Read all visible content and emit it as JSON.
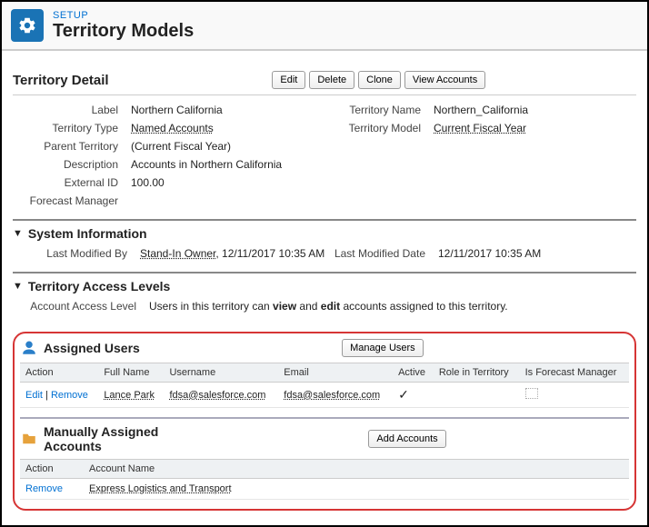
{
  "header": {
    "breadcrumb": "SETUP",
    "title": "Territory Models"
  },
  "detail": {
    "heading": "Territory Detail",
    "buttons": {
      "edit": "Edit",
      "delete": "Delete",
      "clone": "Clone",
      "view_accounts": "View Accounts"
    },
    "left": {
      "label_lbl": "Label",
      "label_val": "Northern California",
      "type_lbl": "Territory Type",
      "type_val": "Named Accounts",
      "parent_lbl": "Parent Territory",
      "parent_val": "(Current Fiscal Year)",
      "desc_lbl": "Description",
      "desc_val": "Accounts in Northern California",
      "ext_lbl": "External ID",
      "ext_val": "100.00",
      "fm_lbl": "Forecast Manager",
      "fm_val": ""
    },
    "right": {
      "tname_lbl": "Territory Name",
      "tname_val": "Northern_California",
      "tmodel_lbl": "Territory Model",
      "tmodel_val": "Current Fiscal Year"
    }
  },
  "sysinfo": {
    "heading": "System Information",
    "lmb_lbl": "Last Modified By",
    "lmb_user": "Stand-In Owner",
    "lmb_time": ", 12/11/2017 10:35 AM",
    "lmd_lbl": "Last Modified Date",
    "lmd_val": "12/11/2017 10:35 AM"
  },
  "access": {
    "heading": "Territory Access Levels",
    "lbl": "Account Access Level",
    "pre": "Users in this territory can ",
    "b1": "view",
    "mid": " and ",
    "b2": "edit",
    "post": " accounts assigned to this territory."
  },
  "assigned_users": {
    "heading": "Assigned Users",
    "manage_btn": "Manage Users",
    "cols": {
      "action": "Action",
      "fullname": "Full Name",
      "username": "Username",
      "email": "Email",
      "active": "Active",
      "role": "Role in Territory",
      "fcmgr": "Is Forecast Manager"
    },
    "rows": [
      {
        "edit": "Edit",
        "remove": "Remove",
        "fullname": "Lance Park",
        "username": "fdsa@salesforce.com",
        "email": "fdsa@salesforce.com",
        "active": "✓",
        "role": "",
        "fcmgr": ""
      }
    ]
  },
  "manual_accounts": {
    "heading": "Manually Assigned Accounts",
    "add_btn": "Add Accounts",
    "cols": {
      "action": "Action",
      "account": "Account Name"
    },
    "rows": [
      {
        "remove": "Remove",
        "name": "Express Logistics and Transport"
      }
    ]
  }
}
